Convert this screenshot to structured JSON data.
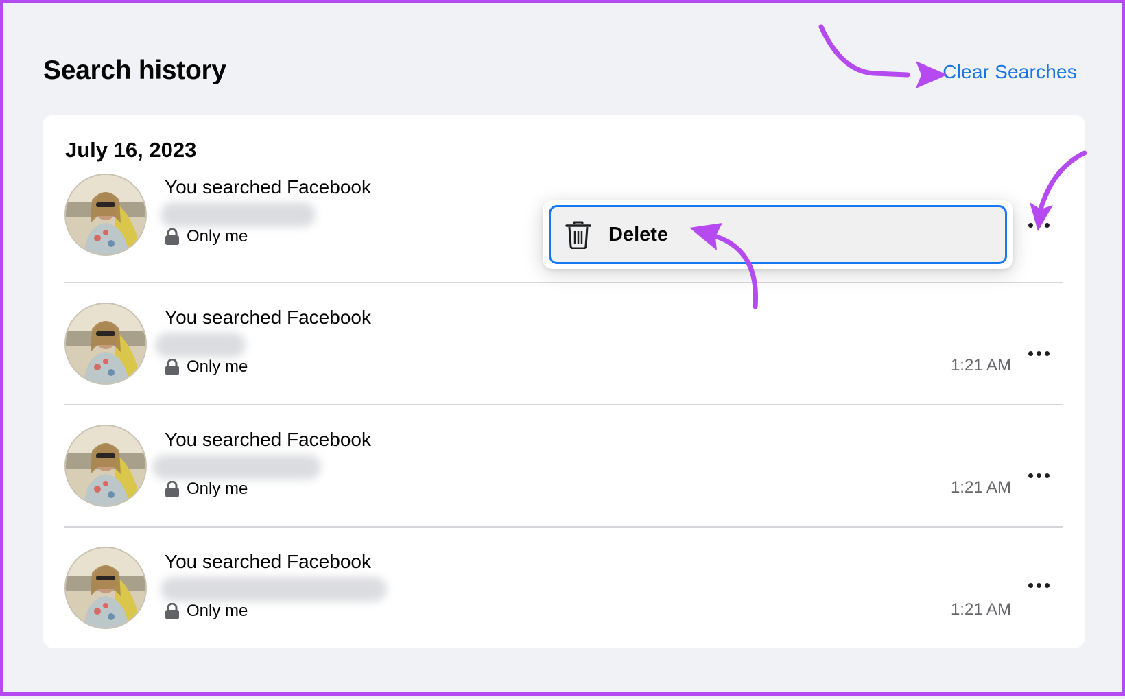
{
  "page": {
    "title": "Search history",
    "clear_label": "Clear Searches"
  },
  "group": {
    "date": "July 16, 2023"
  },
  "entries": [
    {
      "text": "You searched Facebook",
      "privacy": "Only me",
      "time": ""
    },
    {
      "text": "You searched Facebook",
      "privacy": "Only me",
      "time": "1:21 AM"
    },
    {
      "text": "You searched Facebook",
      "privacy": "Only me",
      "time": "1:21 AM"
    },
    {
      "text": "You searched Facebook",
      "privacy": "Only me",
      "time": "1:21 AM"
    }
  ],
  "context_menu": {
    "delete_label": "Delete",
    "icon": "trash-icon"
  },
  "colors": {
    "accent": "#1b74e4",
    "annotation": "#b44af0",
    "background": "#f0f2f5"
  }
}
